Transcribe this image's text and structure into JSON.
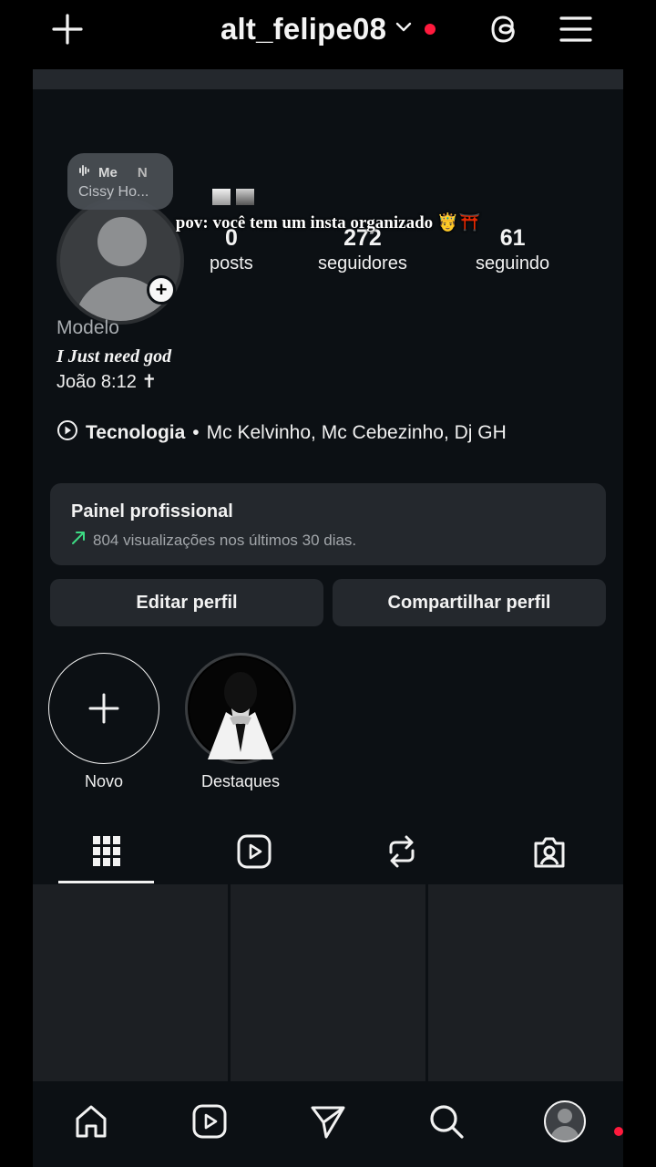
{
  "header": {
    "username": "alt_felipe08",
    "icons": [
      "plus-icon",
      "chevron-down-icon",
      "threads-icon",
      "menu-icon"
    ],
    "notification_color": "#ff1a3d"
  },
  "profile": {
    "note_line1": "Me",
    "note_line1_extra": "N",
    "note_line2": "Cissy Ho...",
    "caption": "pov: você tem um insta organizado 🤴⛩️",
    "stats": [
      {
        "value": "0",
        "label": "posts"
      },
      {
        "value": "272",
        "label": "seguidores"
      },
      {
        "value": "61",
        "label": "seguindo"
      }
    ],
    "name": "Modelo",
    "bio_line1": "I Just need god",
    "bio_line2": "João 8:12 ✝",
    "category": "Tecnologia",
    "category_separator": "•",
    "category_text": "Mc Kelvinho, Mc Cebezinho, Dj GH"
  },
  "panel": {
    "title": "Painel profissional",
    "subtitle": "804 visualizações nos últimos 30 dias.",
    "accent_color": "#3ddc84"
  },
  "buttons": {
    "edit": "Editar perfil",
    "share": "Compartilhar perfil"
  },
  "highlights": [
    {
      "label": "Novo"
    },
    {
      "label": "Destaques"
    }
  ],
  "tabs": [
    "grid-icon",
    "reels-icon",
    "reposts-icon",
    "tagged-icon"
  ],
  "bottom_nav": [
    "home-icon",
    "reels-icon",
    "send-icon",
    "search-icon",
    "profile-avatar"
  ]
}
